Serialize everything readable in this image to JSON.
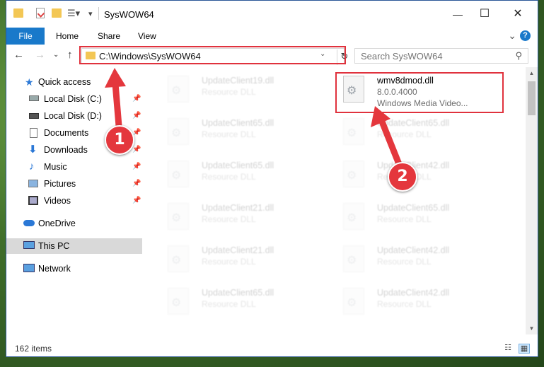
{
  "window": {
    "title": "SysWOW64",
    "controls": {
      "minimize": "—",
      "maximize": "☐",
      "close": "✕"
    }
  },
  "ribbon": {
    "tabs": [
      "File",
      "Home",
      "Share",
      "View"
    ],
    "expand_icon": "chevron-down-icon",
    "help_label": "?"
  },
  "address_bar": {
    "path": "C:\\Windows\\SysWOW64"
  },
  "search": {
    "placeholder": "Search SysWOW64"
  },
  "nav_pane": {
    "items": [
      {
        "label": "Quick access",
        "icon": "star-icon",
        "pinned": false
      },
      {
        "label": "Local Disk (C:)",
        "icon": "drive-icon",
        "pinned": true
      },
      {
        "label": "Local Disk (D:)",
        "icon": "drive-icon",
        "pinned": true
      },
      {
        "label": "Documents",
        "icon": "documents-icon",
        "pinned": true
      },
      {
        "label": "Downloads",
        "icon": "download-icon",
        "pinned": true
      },
      {
        "label": "Music",
        "icon": "music-icon",
        "pinned": true
      },
      {
        "label": "Pictures",
        "icon": "pictures-icon",
        "pinned": true
      },
      {
        "label": "Videos",
        "icon": "videos-icon",
        "pinned": true
      },
      {
        "label": "OneDrive",
        "icon": "cloud-icon",
        "pinned": false
      },
      {
        "label": "This PC",
        "icon": "computer-icon",
        "pinned": false
      },
      {
        "label": "Network",
        "icon": "network-icon",
        "pinned": false
      }
    ]
  },
  "files": {
    "column_left": [
      {
        "name": "UpdateClient19.dll",
        "type": "Resource DLL"
      },
      {
        "name": "UpdateClient65.dll",
        "type": "Resource DLL"
      },
      {
        "name": "UpdateClient65.dll",
        "type": "Resource DLL"
      },
      {
        "name": "UpdateClient21.dll",
        "type": "Resource DLL"
      },
      {
        "name": "UpdateClient21.dll",
        "type": "Resource DLL"
      },
      {
        "name": "UpdateClient65.dll",
        "type": "Resource DLL"
      }
    ],
    "column_right": [
      {
        "name": "wmv8dmod.dll",
        "version": "8.0.0.4000",
        "type": "Windows Media Video...",
        "highlighted": true
      },
      {
        "name": "UpdateClient65.dll",
        "type": "Resource DLL"
      },
      {
        "name": "UpdateClient42.dll",
        "type": "Resource DLL"
      },
      {
        "name": "UpdateClient65.dll",
        "type": "Resource DLL"
      },
      {
        "name": "UpdateClient42.dll",
        "type": "Resource DLL"
      },
      {
        "name": "UpdateClient42.dll",
        "type": "Resource DLL"
      }
    ]
  },
  "status_bar": {
    "item_count": "162 items"
  },
  "annotations": {
    "badge_1": "1",
    "badge_2": "2",
    "highlight_color": "#e0323d"
  },
  "colors": {
    "accent": "#1979ca",
    "selection": "#d9d9d9"
  }
}
